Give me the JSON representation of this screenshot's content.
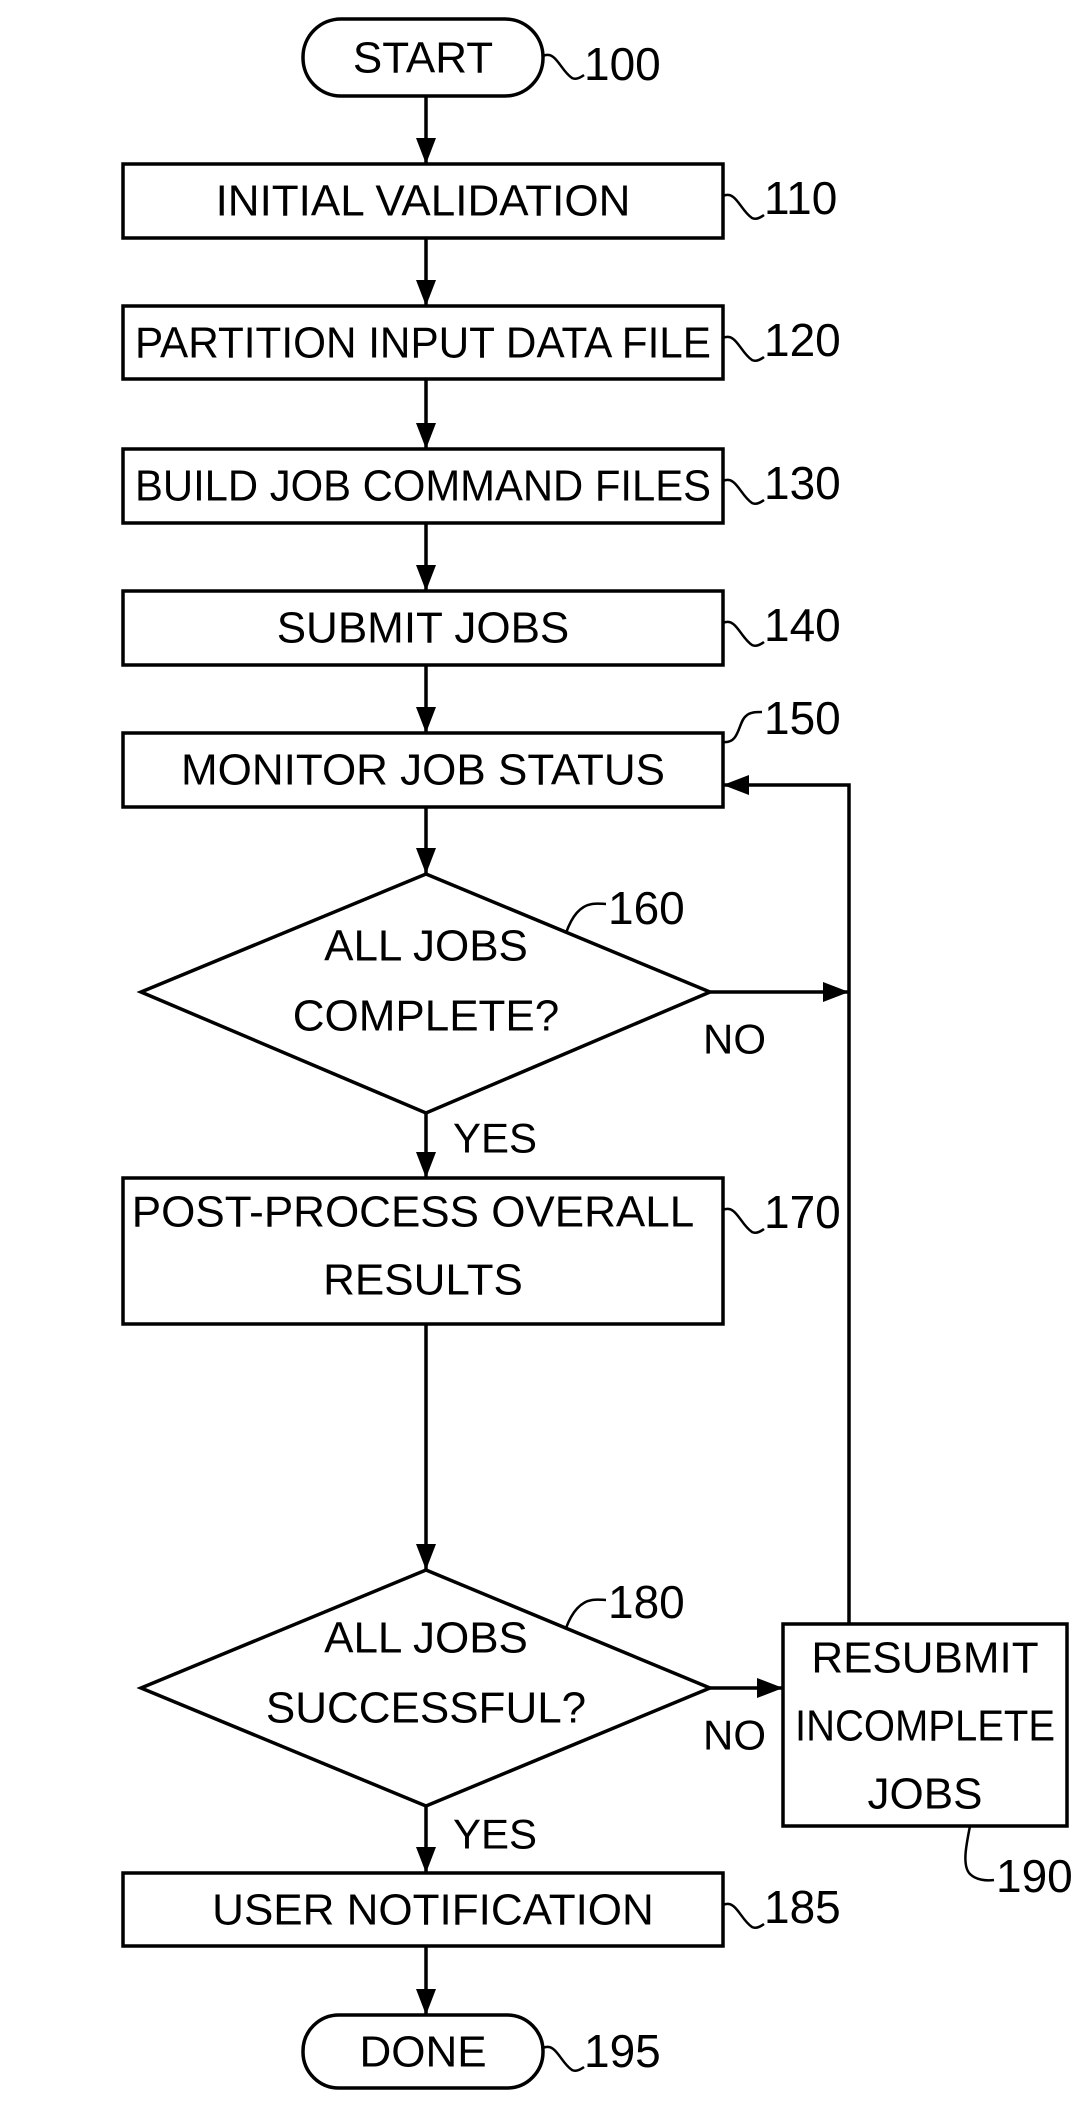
{
  "figure": {
    "type": "flowchart",
    "nodes": [
      {
        "id": "100",
        "kind": "terminal",
        "lines": [
          "START"
        ],
        "ref": "100"
      },
      {
        "id": "110",
        "kind": "process",
        "lines": [
          "INITIAL VALIDATION"
        ],
        "ref": "110"
      },
      {
        "id": "120",
        "kind": "process",
        "lines": [
          "PARTITION INPUT DATA FILE"
        ],
        "ref": "120"
      },
      {
        "id": "130",
        "kind": "process",
        "lines": [
          "BUILD JOB COMMAND FILES"
        ],
        "ref": "130"
      },
      {
        "id": "140",
        "kind": "process",
        "lines": [
          "SUBMIT JOBS"
        ],
        "ref": "140"
      },
      {
        "id": "150",
        "kind": "process",
        "lines": [
          "MONITOR JOB STATUS"
        ],
        "ref": "150"
      },
      {
        "id": "160",
        "kind": "decision",
        "lines": [
          "ALL JOBS",
          "COMPLETE?"
        ],
        "ref": "160"
      },
      {
        "id": "170",
        "kind": "process",
        "lines": [
          "POST-PROCESS OVERALL",
          "RESULTS"
        ],
        "ref": "170"
      },
      {
        "id": "180",
        "kind": "decision",
        "lines": [
          "ALL JOBS",
          "SUCCESSFUL?"
        ],
        "ref": "180"
      },
      {
        "id": "185",
        "kind": "process",
        "lines": [
          "USER NOTIFICATION"
        ],
        "ref": "185"
      },
      {
        "id": "190",
        "kind": "process",
        "lines": [
          "RESUBMIT",
          "INCOMPLETE",
          "JOBS"
        ],
        "ref": "190"
      },
      {
        "id": "195",
        "kind": "terminal",
        "lines": [
          "DONE"
        ],
        "ref": "195"
      }
    ],
    "edges": [
      {
        "from": "100",
        "to": "110",
        "label": ""
      },
      {
        "from": "110",
        "to": "120",
        "label": ""
      },
      {
        "from": "120",
        "to": "130",
        "label": ""
      },
      {
        "from": "130",
        "to": "140",
        "label": ""
      },
      {
        "from": "140",
        "to": "150",
        "label": ""
      },
      {
        "from": "150",
        "to": "160",
        "label": ""
      },
      {
        "from": "160",
        "to": "170",
        "label": "YES"
      },
      {
        "from": "160",
        "to": "150",
        "label": "NO"
      },
      {
        "from": "170",
        "to": "180",
        "label": ""
      },
      {
        "from": "180",
        "to": "185",
        "label": "YES"
      },
      {
        "from": "180",
        "to": "190",
        "label": "NO"
      },
      {
        "from": "190",
        "to": "150",
        "label": ""
      },
      {
        "from": "185",
        "to": "195",
        "label": ""
      }
    ]
  }
}
